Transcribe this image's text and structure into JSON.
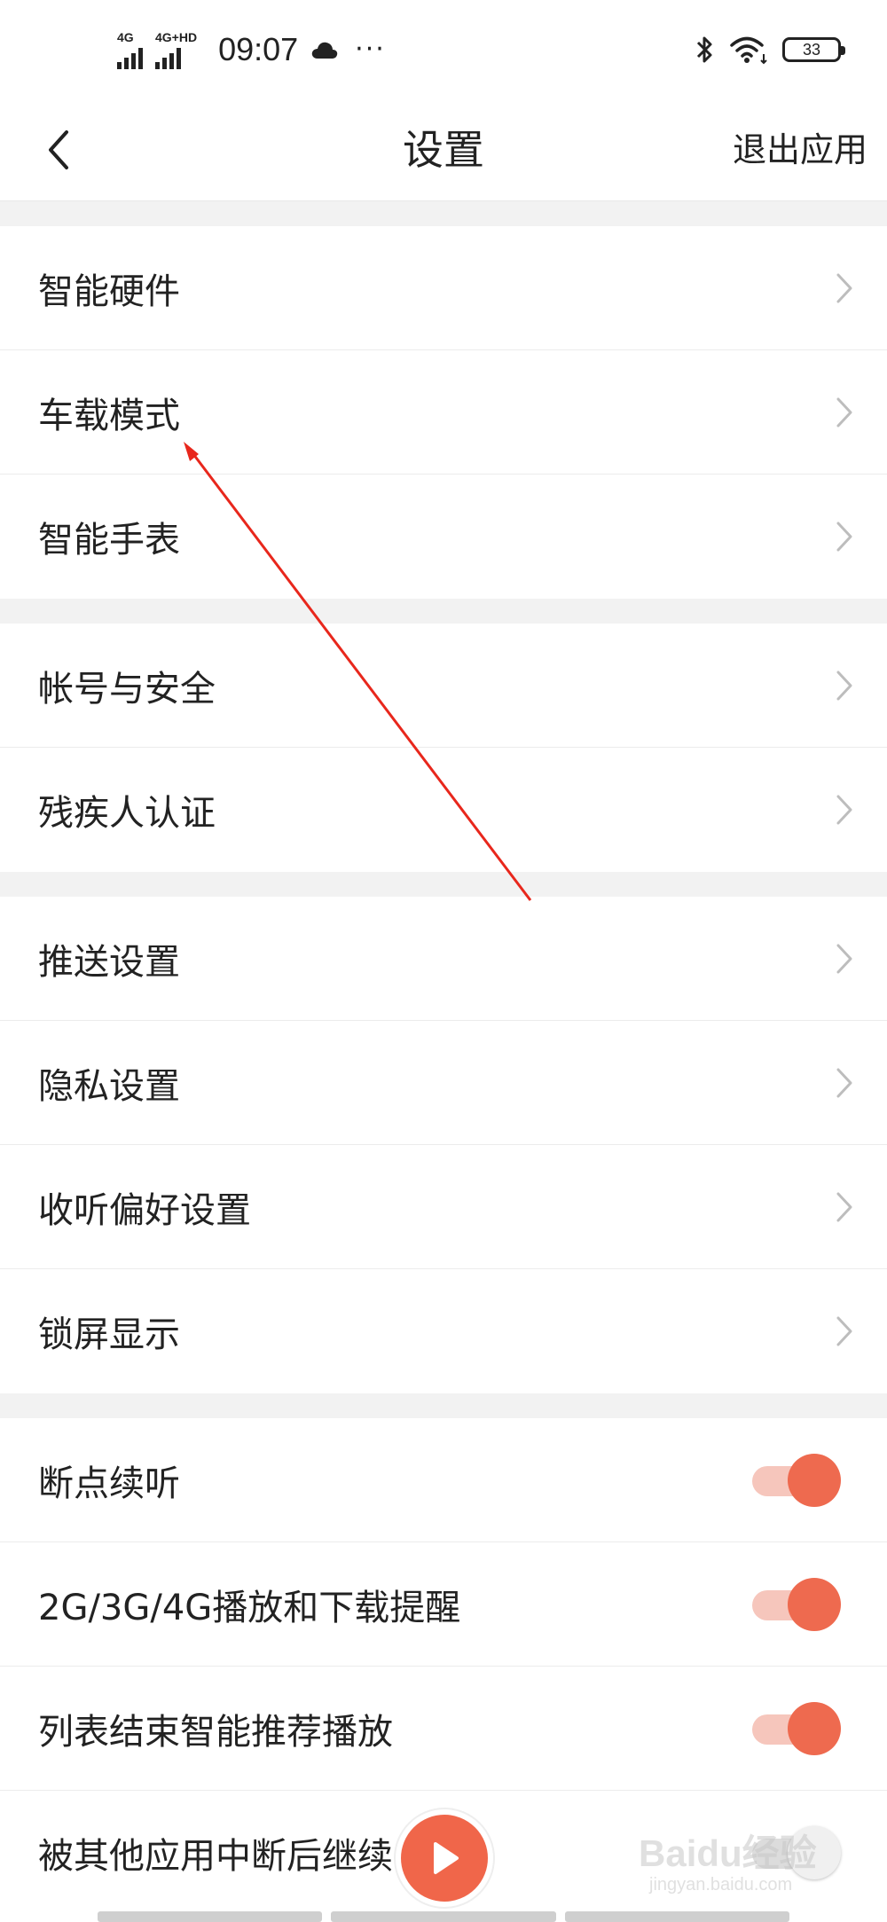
{
  "status_bar": {
    "network_1": "4G",
    "network_2": "4G+HD",
    "time": "09:07",
    "more": "···",
    "battery": "33"
  },
  "nav": {
    "title": "设置",
    "exit_label": "退出应用"
  },
  "sections": [
    {
      "rows": [
        {
          "label": "智能硬件",
          "type": "link"
        },
        {
          "label": "车载模式",
          "type": "link"
        },
        {
          "label": "智能手表",
          "type": "link"
        }
      ]
    },
    {
      "rows": [
        {
          "label": "帐号与安全",
          "type": "link"
        },
        {
          "label": "残疾人认证",
          "type": "link"
        }
      ]
    },
    {
      "rows": [
        {
          "label": "推送设置",
          "type": "link"
        },
        {
          "label": "隐私设置",
          "type": "link"
        },
        {
          "label": "收听偏好设置",
          "type": "link"
        },
        {
          "label": "锁屏显示",
          "type": "link"
        }
      ]
    },
    {
      "rows": [
        {
          "label": "断点续听",
          "type": "toggle",
          "on": true
        },
        {
          "label": "2G/3G/4G播放和下载提醒",
          "type": "toggle",
          "on": true
        },
        {
          "label": "列表结束智能推荐播放",
          "type": "toggle",
          "on": true
        },
        {
          "label": "被其他应用中断后继续",
          "type": "toggle",
          "on": false
        }
      ]
    }
  ],
  "colors": {
    "accent": "#ee6a4f",
    "accent_light": "#f6c6bc",
    "divider": "#f2f2f2",
    "annotation": "#e8271c"
  },
  "watermark": {
    "main": "Baidu经验",
    "sub": "jingyan.baidu.com"
  }
}
